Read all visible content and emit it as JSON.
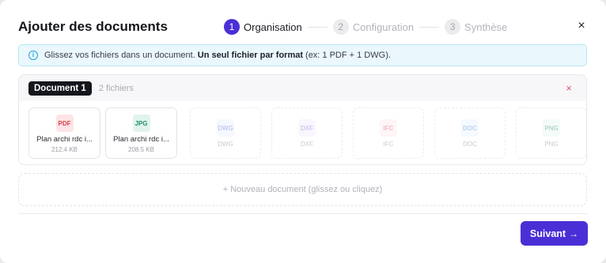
{
  "modal": {
    "title": "Ajouter des documents",
    "close_icon": "×"
  },
  "stepper": [
    {
      "num": "1",
      "label": "Organisation",
      "active": true
    },
    {
      "num": "2",
      "label": "Configuration",
      "active": false
    },
    {
      "num": "3",
      "label": "Synthèse",
      "active": false
    }
  ],
  "info": {
    "icon": "i",
    "text_before": "Glissez vos fichiers dans un document.",
    "text_bold": "Un seul fichier par format",
    "text_after": "(ex: 1 PDF + 1 DWG)."
  },
  "document": {
    "badge": "Document 1",
    "count": "2 fichiers",
    "remove_icon": "×",
    "files": [
      {
        "type": "PDF",
        "name": "Plan archi rdc i...",
        "size": "212.4 KB",
        "color": "#d9434f",
        "bg": "#fde4e6"
      },
      {
        "type": "JPG",
        "name": "Plan archi rdc i...",
        "size": "208.5 KB",
        "color": "#2a8f6e",
        "bg": "#e0f4ec"
      }
    ],
    "slots": [
      {
        "type": "DWG",
        "label": "DWG",
        "color": "#4f6fd6",
        "bg": "#e5ecfd"
      },
      {
        "type": "DXF",
        "label": "DXF",
        "color": "#7d5fd6",
        "bg": "#eee7fd"
      },
      {
        "type": "IFC",
        "label": "IFC",
        "color": "#d9434f",
        "bg": "#fde4e6"
      },
      {
        "type": "DOC",
        "label": "DOC",
        "color": "#3f7fd6",
        "bg": "#e3eefd"
      },
      {
        "type": "PNG",
        "label": "PNG",
        "color": "#2a8f6e",
        "bg": "#e0f4ec"
      }
    ]
  },
  "new_document": {
    "plus": "+",
    "label": "+ Nouveau document (glissez ou cliquez)"
  },
  "footer": {
    "next_label": "Suivant",
    "next_arrow": "→"
  }
}
